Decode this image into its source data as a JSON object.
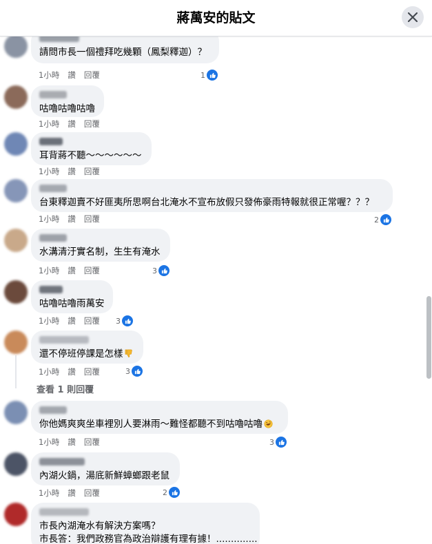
{
  "header": {
    "title": "蔣萬安的貼文"
  },
  "comments": [
    {
      "text": "請問市長一個禮拜吃幾顆（鳳梨釋迦）？",
      "time": "1小時",
      "like": "讚",
      "reply": "回覆",
      "reactions": "1",
      "avatar_color": "#8a93a3",
      "name_color": "#9aa0a8"
    },
    {
      "text": "咕嚕咕嚕咕嚕",
      "time": "1小時",
      "like": "讚",
      "reply": "回覆",
      "reactions": "",
      "avatar_color": "#8b6a5a",
      "name_color": "#a9acb1"
    },
    {
      "text": "耳背蔣不聽～～～～～～",
      "time": "1小時",
      "like": "讚",
      "reply": "回覆",
      "reactions": "",
      "avatar_color": "#6f87b5",
      "name_color": "#6b7079"
    },
    {
      "text": "台東釋迦賣不好匪夷所思啊台北淹水不宣布放假只發佈豪雨特報就很正常喔？？？",
      "time": "1小時",
      "like": "讚",
      "reply": "回覆",
      "reactions": "2",
      "avatar_color": "#8696b8",
      "name_color": "#a5a9b0"
    },
    {
      "text": "水溝清汙實名制，生生有淹水",
      "time": "1小時",
      "like": "讚",
      "reply": "回覆",
      "reactions": "3",
      "avatar_color": "#c9a98a",
      "name_color": "#9ea2a9"
    },
    {
      "text": "咕嚕咕嚕雨萬安",
      "time": "1小時",
      "like": "讚",
      "reply": "回覆",
      "reactions": "3",
      "avatar_color": "#6b4a3c",
      "name_color": "#70757d"
    },
    {
      "text": "還不停班停課是怎樣",
      "time": "1小時",
      "like": "讚",
      "reply": "回覆",
      "reactions": "3",
      "avatar_color": "#c98a5a",
      "name_color": "#b7bac0"
    },
    {
      "text": "你他媽爽爽坐車裡別人要淋雨～難怪都聽不到咕嚕咕嚕",
      "time": "1小時",
      "like": "讚",
      "reply": "回覆",
      "reactions": "3",
      "avatar_color": "#7b8fb3",
      "name_color": "#a3a7ae"
    },
    {
      "text": "內湖火鍋，湯底新鮮蟑螂跟老鼠",
      "time": "1小時",
      "like": "讚",
      "reply": "回覆",
      "reactions": "2",
      "avatar_color": "#4c5466",
      "name_color": "#8d9199"
    },
    {
      "text": "市長內湖淹水有解決方案嗎？",
      "text2": "市長答：我們政務官為政治辯護有理有據！..............",
      "avatar_color": "#b02a2a",
      "name_color": "#b5b8bd"
    }
  ],
  "view_replies": "查看 1 則回覆",
  "colors": {
    "like_blue": "#1b74e4",
    "bubble_bg": "#f0f2f5",
    "meta_gray": "#65676b"
  },
  "icons": {
    "close": "close-icon",
    "like": "thumbs-up-icon",
    "thumbs_down": "thumbs-down-emoji",
    "laughing": "rofl-emoji"
  }
}
